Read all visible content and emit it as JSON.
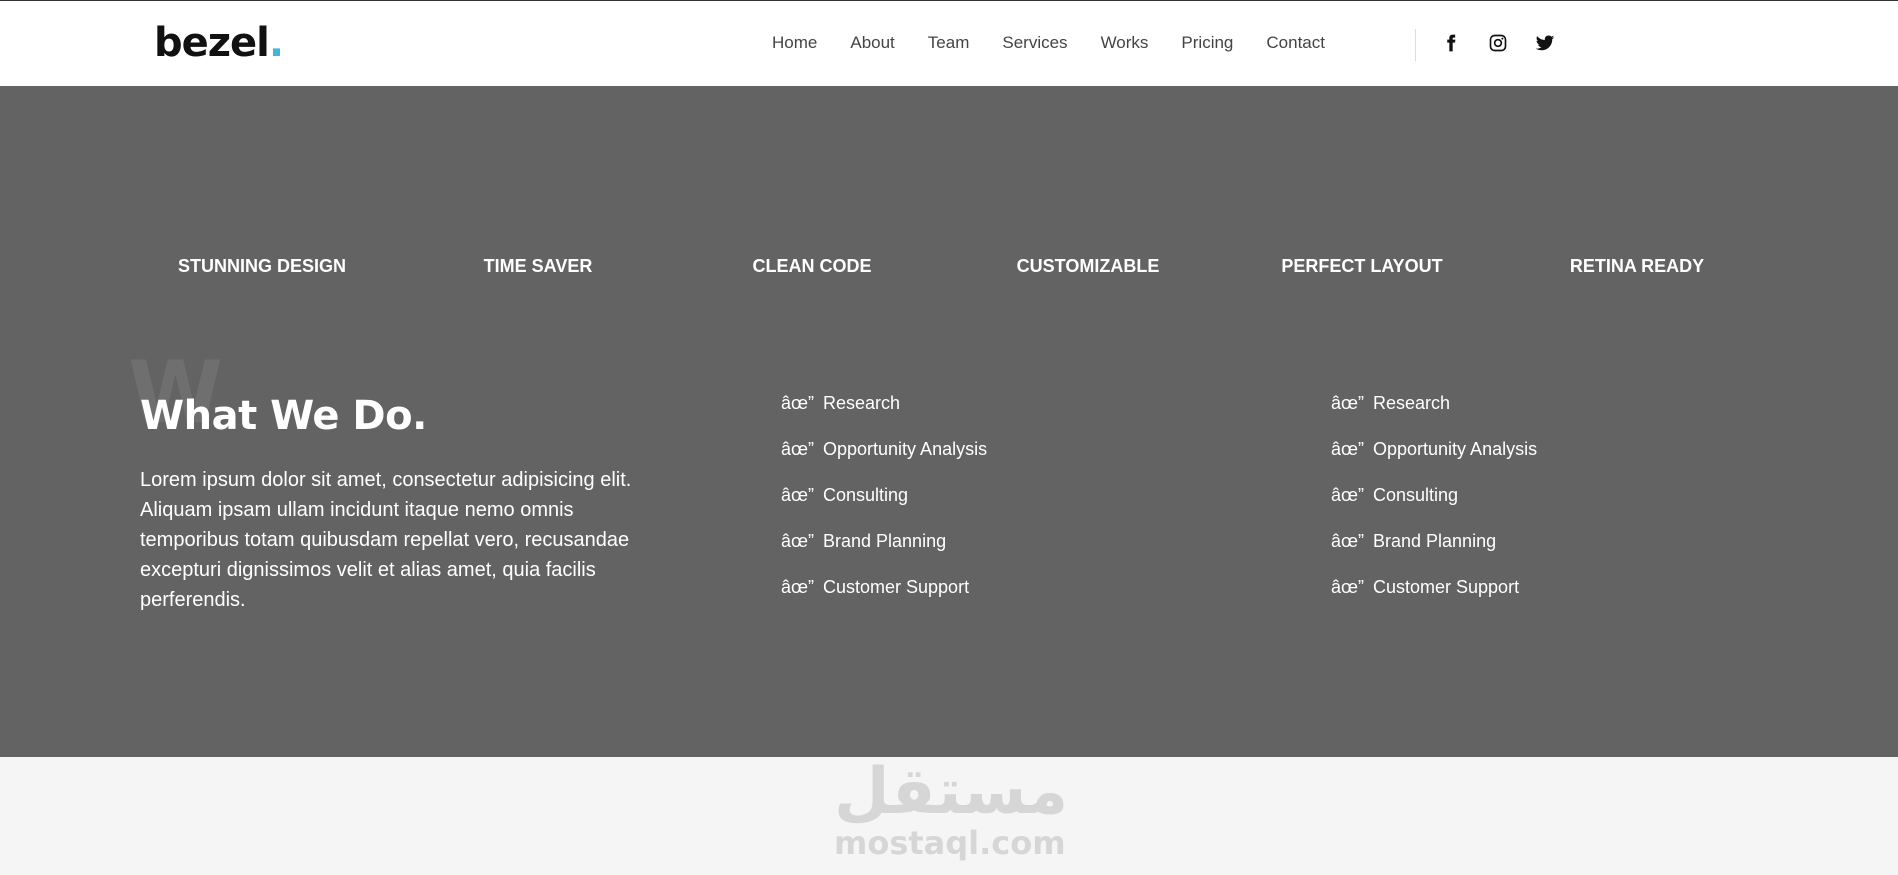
{
  "header": {
    "logo_text": "bezel",
    "logo_dot": ".",
    "nav": [
      "Home",
      "About",
      "Team",
      "Services",
      "Works",
      "Pricing",
      "Contact"
    ],
    "social_icons": [
      "facebook-icon",
      "instagram-icon",
      "twitter-icon"
    ]
  },
  "features": [
    "STUNNING DESIGN",
    "TIME SAVER",
    "CLEAN CODE",
    "CUSTOMIZABLE",
    "PERFECT LAYOUT",
    "RETINA READY"
  ],
  "what_we_do": {
    "bg_letter": "W",
    "title": "What We Do.",
    "paragraph": "Lorem ipsum dolor sit amet, consectetur adipisicing elit. Aliquam ipsam ullam incidunt itaque nemo omnis temporibus totam quibusdam repellat vero, recusandae excepturi dignissimos velit et alias amet, quia facilis perferendis.",
    "list_marker": "âœ”",
    "list_left": [
      "Research",
      "Opportunity Analysis",
      "Consulting",
      "Brand Planning",
      "Customer Support"
    ],
    "list_right": [
      "Research",
      "Opportunity Analysis",
      "Consulting",
      "Brand Planning",
      "Customer Support"
    ]
  },
  "watermark": {
    "arabic": "مستقل",
    "latin": "mostaql.com"
  },
  "colors": {
    "accent": "#3fb6e0",
    "dark_section": "#636363",
    "header_bg": "#ffffff",
    "footer_bg": "#f5f5f5"
  }
}
